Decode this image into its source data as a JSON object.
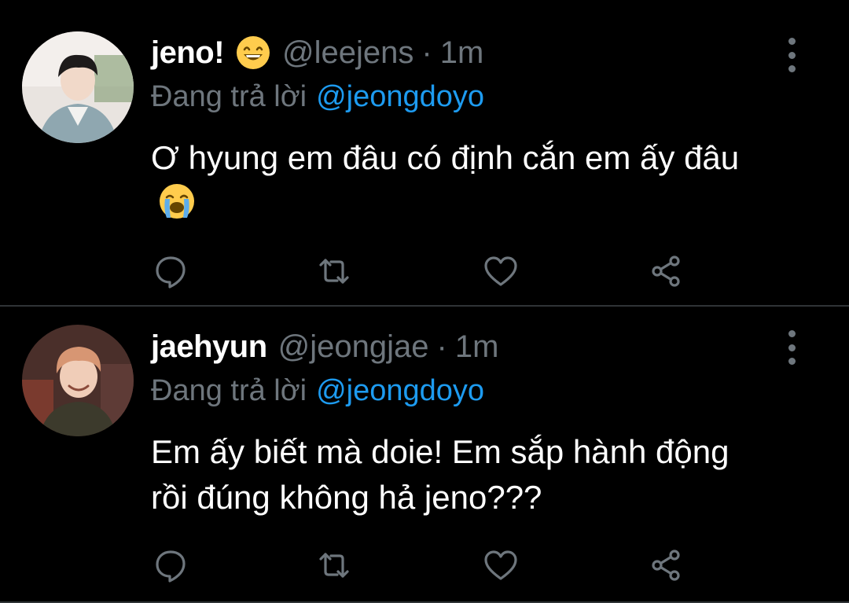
{
  "colors": {
    "background": "#000000",
    "text_primary": "#ffffff",
    "text_secondary": "#6e767d",
    "accent": "#1d9bf0",
    "divider": "#2f3336"
  },
  "tweets": [
    {
      "display_name": "jeno!",
      "name_emoji": "grinning-face-with-smiling-eyes-emoji",
      "handle": "@leejens",
      "separator": "·",
      "time": "1m",
      "reply_label": "Đang trả lời",
      "reply_to": "@jeongdoyo",
      "text": "Ơ hyung em đâu có định cắn em ấy đâu",
      "text_emoji": "loudly-crying-face-emoji",
      "actions": [
        "reply-icon",
        "retweet-icon",
        "like-icon",
        "share-icon"
      ]
    },
    {
      "display_name": "jaehyun",
      "handle": "@jeongjae",
      "separator": "·",
      "time": "1m",
      "reply_label": "Đang trả lời",
      "reply_to": "@jeongdoyo",
      "text": "Em ấy biết mà doie! Em sắp hành động rồi đúng không hả jeno???",
      "actions": [
        "reply-icon",
        "retweet-icon",
        "like-icon",
        "share-icon"
      ]
    }
  ]
}
